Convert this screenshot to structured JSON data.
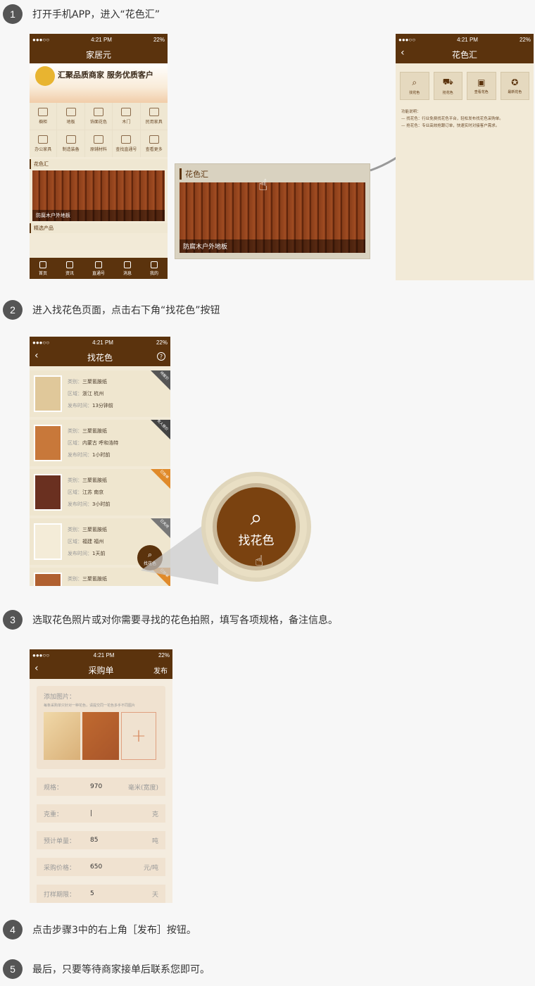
{
  "steps": [
    {
      "num": "1",
      "text": "打开手机APP，进入“花色汇”"
    },
    {
      "num": "2",
      "text": "进入找花色页面，点击右下角“找花色”按钮"
    },
    {
      "num": "3",
      "text": "选取花色照片或对你需要寻找的花色拍照，填写各项规格，备注信息。"
    },
    {
      "num": "4",
      "text": "点击步骤3中的右上角［发布］按钮。"
    },
    {
      "num": "5",
      "text": "最后，只要等待商家接单后联系您即可。"
    }
  ],
  "status": {
    "carrier": "●●●○○",
    "time": "4:21 PM",
    "battery": "22%"
  },
  "phone1": {
    "title": "家居元",
    "banner_text": "汇聚品质商家  服务优质客户",
    "grid": [
      "橱柜",
      "地板",
      "饰面花色",
      "木门",
      "民用家具",
      "办公家具",
      "制造装备",
      "原辅材料",
      "查找直通号",
      "查看更多"
    ],
    "section1": "花色汇",
    "wood_caption": "防腐木户外地板",
    "section2": "精选产品",
    "tabs": [
      "首页",
      "资讯",
      "直通号",
      "消息",
      "我的"
    ]
  },
  "zoom1": {
    "title": "花色汇",
    "caption": "防腐木户外地板"
  },
  "phone_hs": {
    "title": "花色汇",
    "icons": [
      "找花色",
      "抢花色",
      "查看花色",
      "最新花色"
    ],
    "desc_title": "功能说明：",
    "desc1": "— 找花色：行业免费找花色平台，轻松发布找花色采购单。",
    "desc2": "— 抢花色：专业高效抢跟订单，快速实时对接客户需求。"
  },
  "phone2": {
    "title": "找花色",
    "help": "?",
    "label_type": "类别：",
    "label_area": "区域：",
    "label_time": "发布时间：",
    "items": [
      {
        "type": "三聚氰胺纸",
        "area": "浙江  杭州",
        "time": "13分钟前",
        "badge": "待报价",
        "badge_color": "#555555",
        "color": "#e0c89a"
      },
      {
        "type": "三聚氰胺纸",
        "area": "内蒙古  呼和浩特",
        "time": "1小时前",
        "badge": "有人报价",
        "badge_color": "#444444",
        "color": "#c8783a"
      },
      {
        "type": "三聚氰胺纸",
        "area": "江苏  南京",
        "time": "3小时前",
        "badge": "已抢单",
        "badge_color": "#e08a2a",
        "color": "#6a3020"
      },
      {
        "type": "三聚氰胺纸",
        "area": "福建  福州",
        "time": "1天前",
        "badge": "已关闭",
        "badge_color": "#777777",
        "color": "#f4ecd8"
      },
      {
        "type": "三聚氰胺纸",
        "area": "",
        "time": "",
        "badge": "已抢单",
        "badge_color": "#e08a2a",
        "color": "#b06030"
      }
    ],
    "fab_label": "找花色"
  },
  "zoom2": {
    "label": "找花色"
  },
  "phone3": {
    "title": "采购单",
    "publish": "发布",
    "add_image": "添加图片：",
    "add_hint": "每条采购单只针对一种花色，请提交同一花色多手不同图片",
    "fields": [
      {
        "label": "规格：",
        "value": "970",
        "unit": "毫米(宽度)"
      },
      {
        "label": "克重：",
        "value": "|",
        "unit": "克"
      },
      {
        "label": "预计单量：",
        "value": "85",
        "unit": "吨"
      },
      {
        "label": "采购价格：",
        "value": "650",
        "unit": "元/吨"
      },
      {
        "label": "打样期限：",
        "value": "5",
        "unit": "天"
      }
    ]
  }
}
